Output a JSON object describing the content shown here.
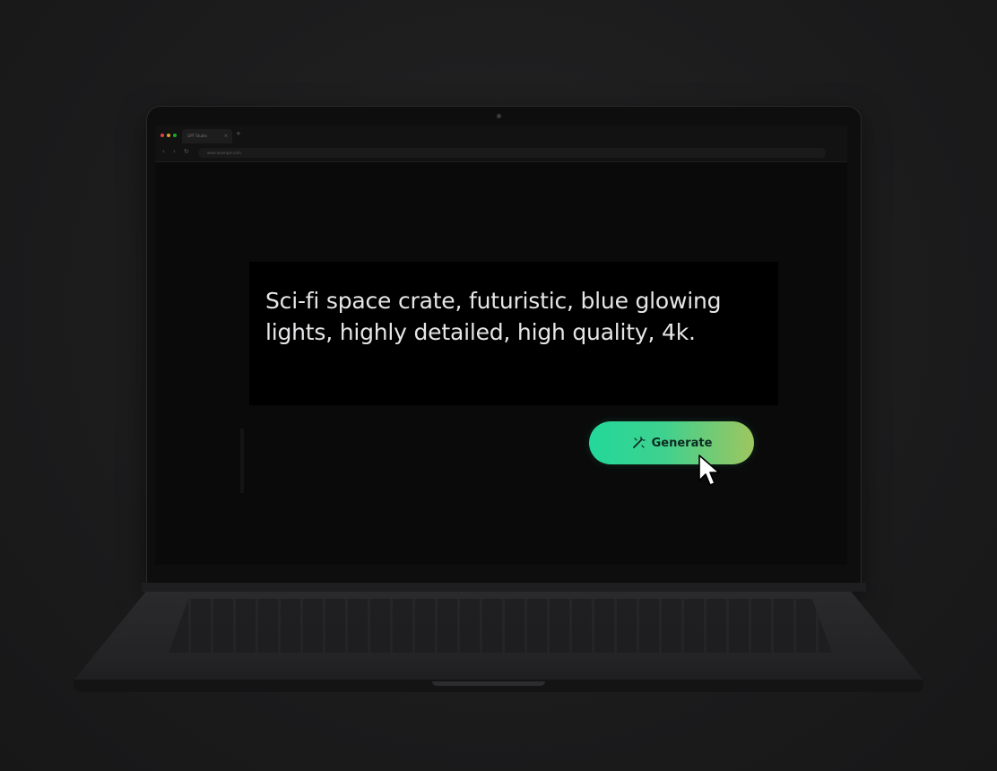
{
  "browser": {
    "tab_label": "GPT Studio",
    "tab_close": "×",
    "new_tab": "+",
    "back": "‹",
    "forward": "›",
    "reload": "↻",
    "address": "www.example.com"
  },
  "prompt": {
    "text": "Sci-fi space crate, futuristic, blue glowing lights, highly detailed, high quality, 4k."
  },
  "generate": {
    "label": "Generate",
    "icon": "magic-wand-icon"
  },
  "colors": {
    "traffic_red": "#e0443e",
    "traffic_yellow": "#dea123",
    "traffic_green": "#1aab29",
    "button_gradient_start": "#22d89a",
    "button_gradient_end": "#9ec65f"
  }
}
